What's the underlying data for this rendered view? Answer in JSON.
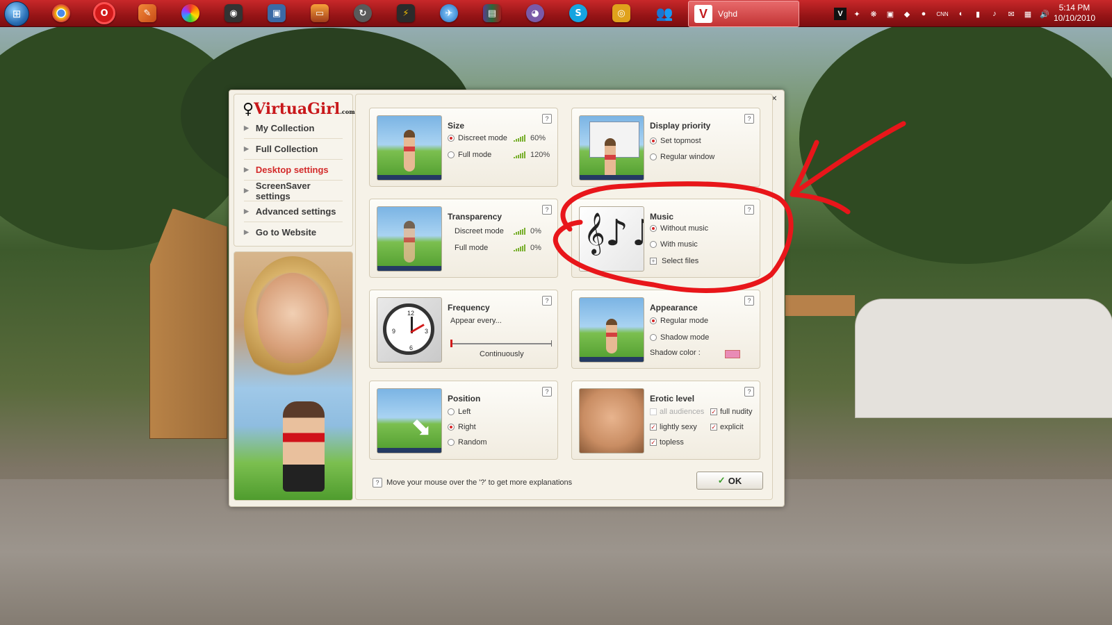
{
  "taskbar": {
    "active_task_label": "Vghd",
    "active_task_glyph": "V",
    "pinned_icons": [
      "chrome-icon",
      "opera-icon",
      "app-icon",
      "picasa-icon",
      "camera-icon",
      "screen-icon",
      "photo-icon",
      "sync-icon",
      "winamp-icon",
      "email-icon",
      "rar-icon",
      "pidgin-icon",
      "skype-icon",
      "target-icon",
      "messenger-icon"
    ],
    "clock_time": "5:14 PM",
    "clock_date": "10/10/2010",
    "tray_text": "CNN"
  },
  "dialog": {
    "close_label": "×",
    "logo_part1": "VirtuaGirl",
    "logo_part2": ".com",
    "nav_items": [
      {
        "label": "My Collection"
      },
      {
        "label": "Full Collection"
      },
      {
        "label": "Desktop settings"
      },
      {
        "label": "ScreenSaver settings"
      },
      {
        "label": "Advanced settings"
      },
      {
        "label": "Go to Website"
      }
    ],
    "help_glyph": "?",
    "size": {
      "title": "Size",
      "opt1": "Discreet mode",
      "opt1_value": "60%",
      "opt2": "Full mode",
      "opt2_value": "120%",
      "selected": "Discreet mode"
    },
    "display_priority": {
      "title": "Display priority",
      "opt1": "Set topmost",
      "opt2": "Regular window",
      "selected": "Set topmost"
    },
    "transparency": {
      "title": "Transparency",
      "opt1": "Discreet mode",
      "opt1_value": "0%",
      "opt2": "Full mode",
      "opt2_value": "0%"
    },
    "music": {
      "title": "Music",
      "opt1": "Without music",
      "opt2": "With music",
      "opt3": "Select files",
      "selected": "Without music"
    },
    "frequency": {
      "title": "Frequency",
      "subtitle": "Appear every...",
      "slider_label": "Continuously",
      "slider_value": 0
    },
    "appearance": {
      "title": "Appearance",
      "opt1": "Regular mode",
      "opt2": "Shadow mode",
      "shadow_label": "Shadow color :",
      "shadow_color": "#e98bb6",
      "selected": "Regular mode"
    },
    "position": {
      "title": "Position",
      "opt1": "Left",
      "opt2": "Right",
      "opt3": "Random",
      "selected": "Right"
    },
    "erotic_level": {
      "title": "Erotic level",
      "options": [
        {
          "label": "all audiences",
          "checked": false,
          "disabled": true
        },
        {
          "label": "full nudity",
          "checked": true
        },
        {
          "label": "lightly sexy",
          "checked": true
        },
        {
          "label": "explicit",
          "checked": true
        },
        {
          "label": "topless",
          "checked": true
        }
      ]
    },
    "footer_hint": "Move your mouse over the '?' to get more explanations",
    "ok_label": "OK",
    "ok_check": "✓"
  },
  "colors": {
    "accent": "#d32a2a",
    "annotation": "#e8161a",
    "taskbar": "#a81a1c"
  }
}
